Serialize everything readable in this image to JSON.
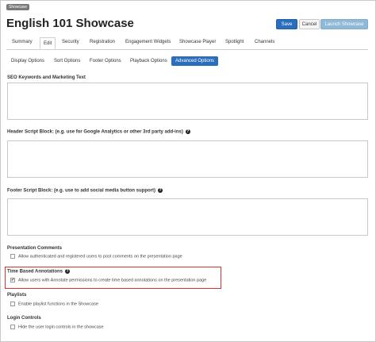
{
  "header": {
    "tagline": "Showcase",
    "title": "English 101 Showcase",
    "save_label": "Save",
    "cancel_label": "Cancel",
    "launch_label": "Launch Showcase"
  },
  "tabs": [
    "Summary",
    "Edit",
    "Security",
    "Registration",
    "Engagement Widgets",
    "Showcase Player",
    "Spotlight",
    "Channels"
  ],
  "subtabs": [
    "Display Options",
    "Sort Options",
    "Footer Options",
    "Playback Options",
    "Advanced Options"
  ],
  "sections": {
    "seo": {
      "label": "SEO Keywords and Marketing Text",
      "value": ""
    },
    "header_script": {
      "label": "Header Script Block: (e.g. use for Google Analytics or other 3rd party add-ins)",
      "value": ""
    },
    "footer_script": {
      "label": "Footer Script Block: (e.g. use to add social media button support)",
      "value": ""
    },
    "presentation_comments": {
      "label": "Presentation Comments",
      "option": "Allow authenticated and registered users to post comments on the presentation page",
      "checked": false
    },
    "time_based_annotations": {
      "label": "Time Based Annotations",
      "option": "Allow users with Annotate permissions to create time based annotations on the presentation page",
      "checked": true
    },
    "playlists": {
      "label": "Playlists",
      "option": "Enable playlist functions in the Showcase",
      "checked": false
    },
    "login_controls": {
      "label": "Login Controls",
      "option": "Hide the user login controls in the showcase",
      "checked": false
    }
  },
  "icons": {
    "help": "help-circle-icon",
    "check": "checkmark-icon"
  },
  "colors": {
    "primary": "#2a6ebb",
    "highlight": "#d9322e",
    "launch": "#8fb9d6"
  }
}
